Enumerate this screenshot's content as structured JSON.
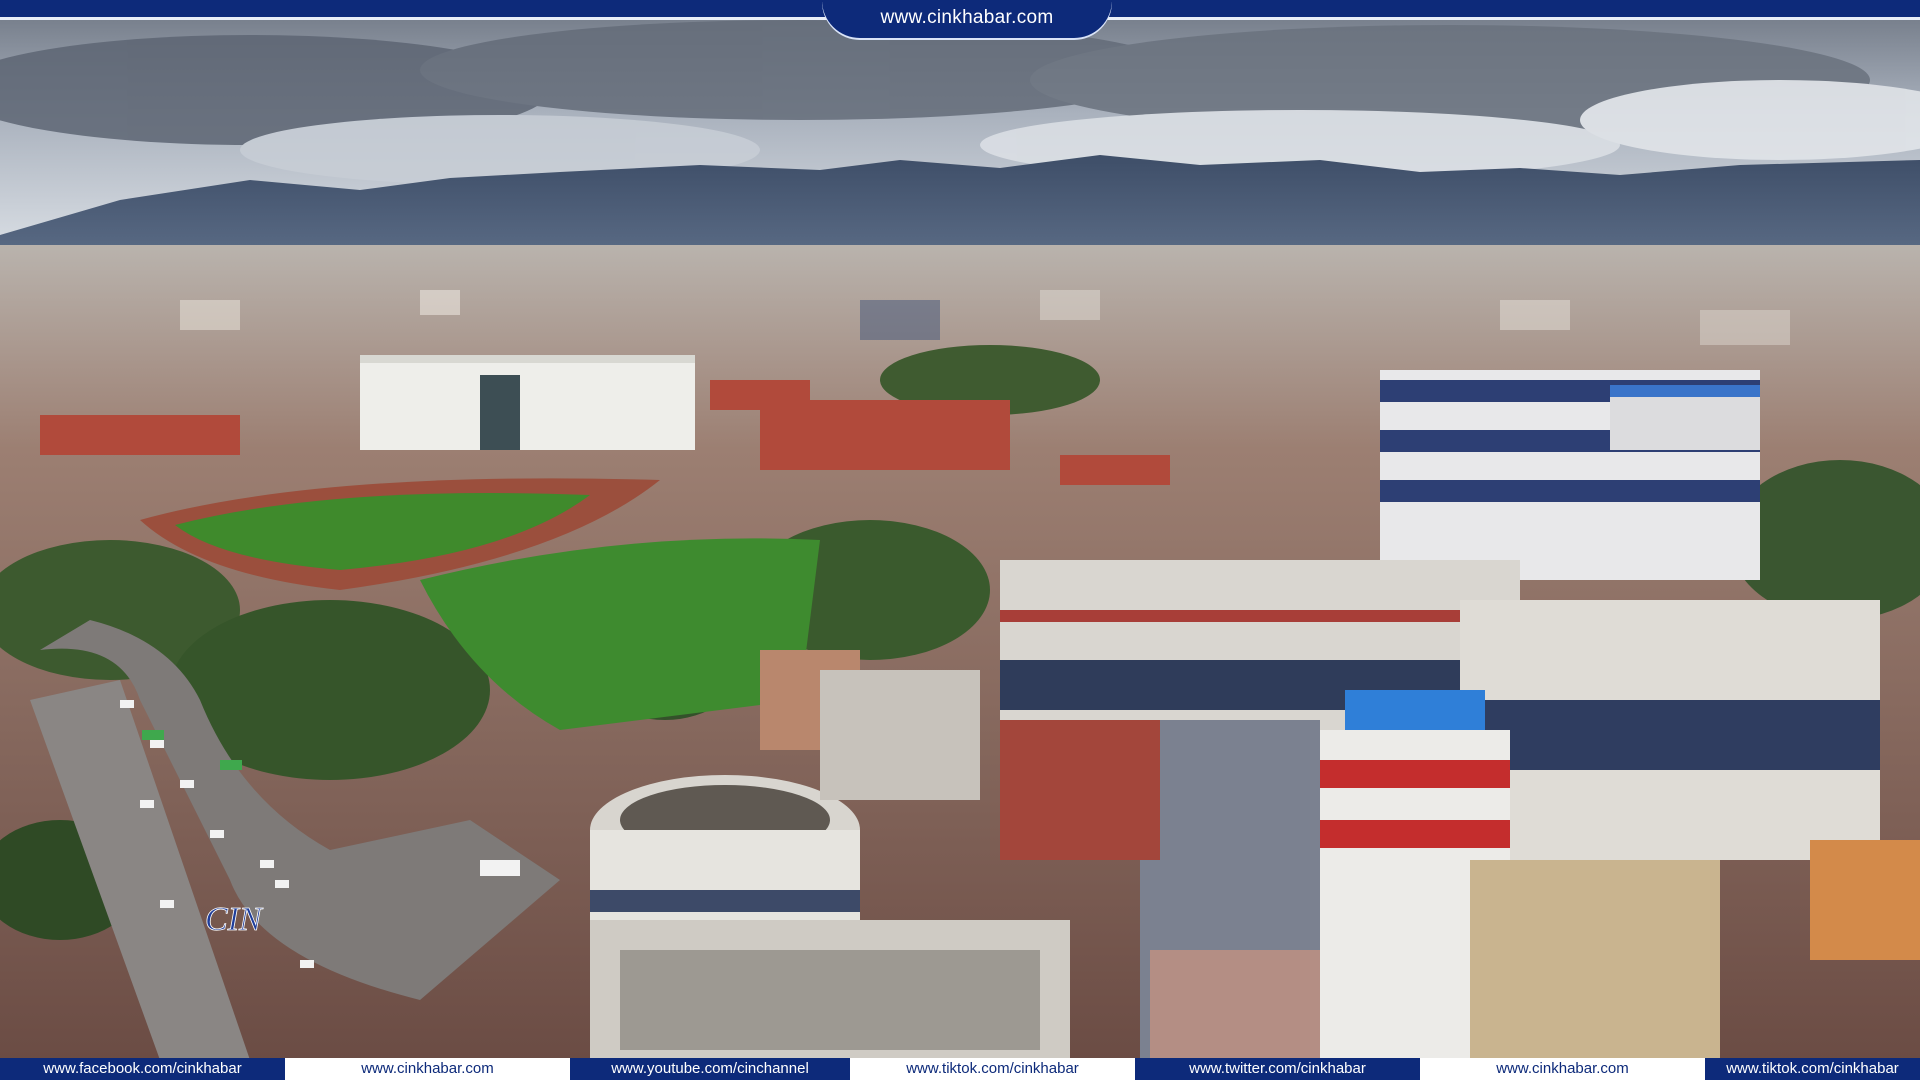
{
  "header": {
    "site_url": "www.cinkhabar.com"
  },
  "footer": {
    "links": [
      "www.facebook.com/cinkhabar",
      "www.cinkhabar.com",
      "www.youtube.com/cinchannel",
      "www.tiktok.com/cinkhabar",
      "www.twitter.com/cinkhabar",
      "www.cinkhabar.com",
      "www.tiktok.com/cinkhabar"
    ]
  },
  "logo": {
    "text": "CIN"
  },
  "colors": {
    "brand": "#0d2a7a",
    "light": "#ffffff"
  }
}
